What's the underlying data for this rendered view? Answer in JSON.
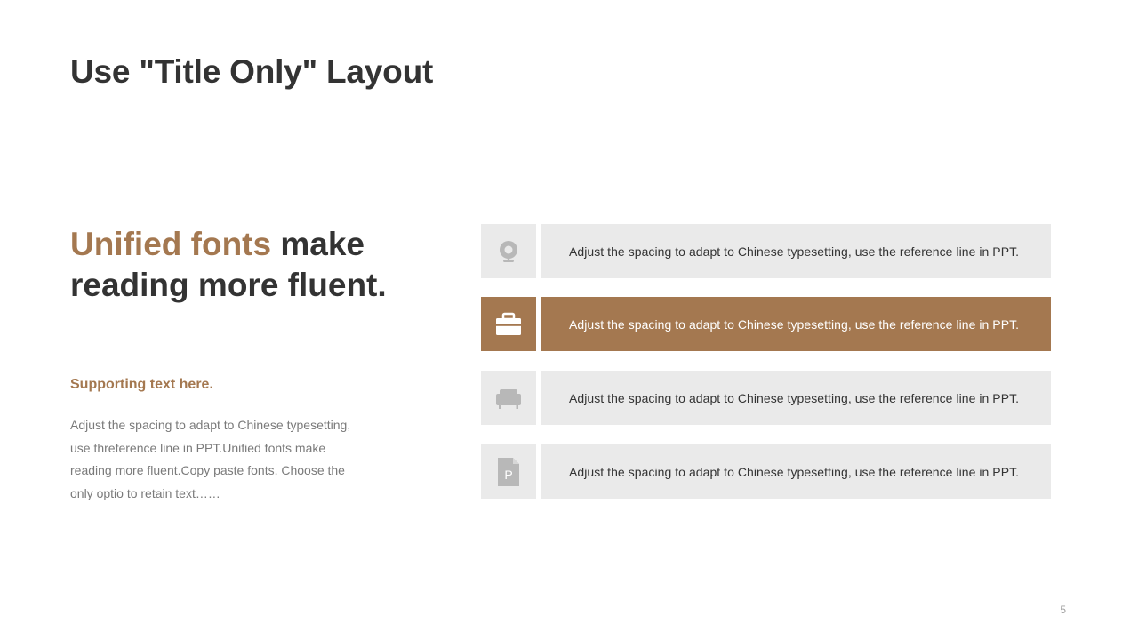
{
  "slide": {
    "title": "Use \"Title Only\" Layout",
    "headline": {
      "accent": "Unified fonts",
      "rest": " make reading more fluent."
    },
    "supporting_title": "Supporting text here.",
    "supporting_body": "Adjust the spacing to adapt to Chinese typesetting, use threference line in PPT.Unified fonts make reading more fluent.Copy paste fonts. Choose the only optio to retain text……",
    "page_number": "5"
  },
  "rows": [
    {
      "icon": "webcam-icon",
      "text": "Adjust the spacing to adapt to Chinese typesetting, use the reference line in PPT.",
      "active": false
    },
    {
      "icon": "briefcase-icon",
      "text": "Adjust the spacing to adapt to Chinese typesetting, use the reference line in PPT.",
      "active": true
    },
    {
      "icon": "armchair-icon",
      "text": "Adjust the spacing to adapt to Chinese typesetting, use the reference line in PPT.",
      "active": false
    },
    {
      "icon": "document-p-icon",
      "text": "Adjust the spacing to adapt to Chinese typesetting, use the reference line in PPT.",
      "active": false
    }
  ],
  "colors": {
    "accent": "#a47850",
    "text_dark": "#333333",
    "text_muted": "#7a7a7a",
    "panel_bg": "#eaeaea",
    "icon_gray": "#b8b8b8",
    "icon_white": "#ffffff",
    "page_number": "#a0a0a0"
  }
}
